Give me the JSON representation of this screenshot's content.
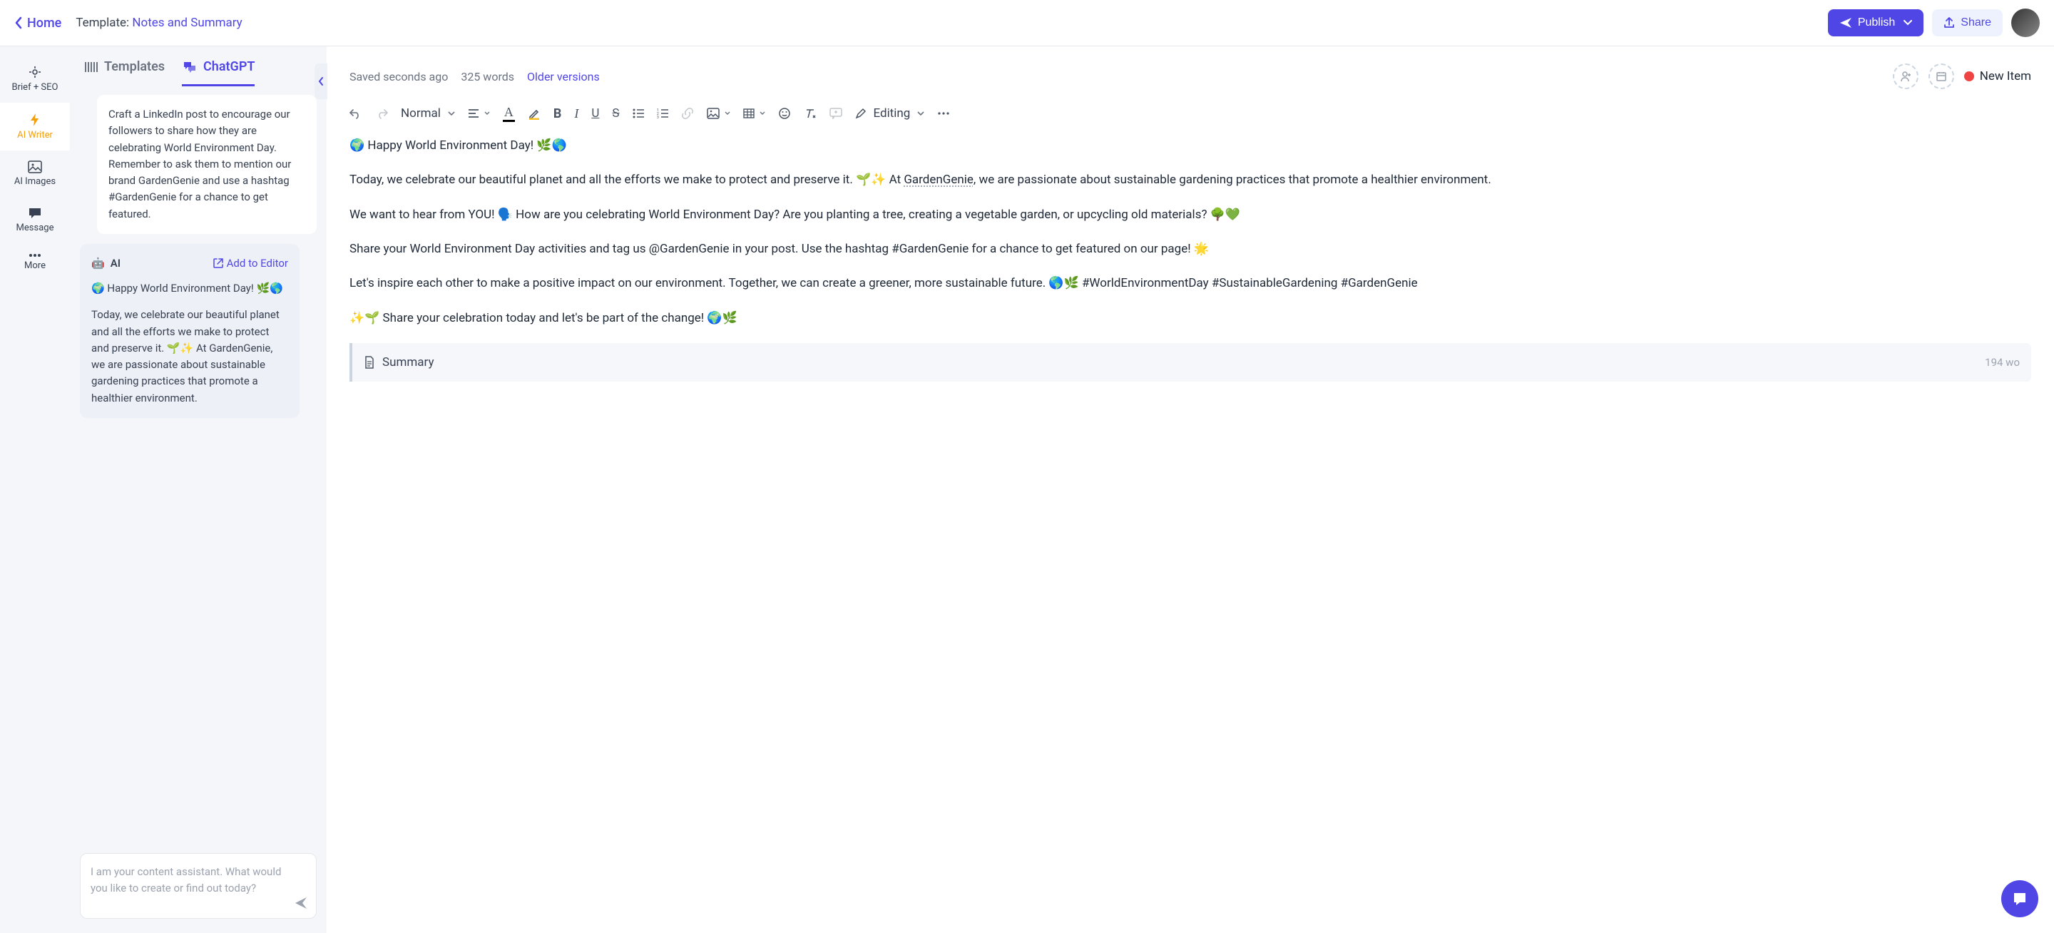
{
  "topbar": {
    "home": "Home",
    "template_prefix": "Template: ",
    "template_name": "Notes and Summary",
    "publish": "Publish",
    "share": "Share"
  },
  "leftnav": {
    "items": [
      {
        "label": "Brief + SEO",
        "icon": "target"
      },
      {
        "label": "AI Writer",
        "icon": "bolt"
      },
      {
        "label": "AI Images",
        "icon": "image"
      },
      {
        "label": "Message",
        "icon": "chat"
      },
      {
        "label": "More",
        "icon": "dots"
      }
    ],
    "active_index": 1
  },
  "side": {
    "tabs": {
      "templates": "Templates",
      "chatgpt": "ChatGPT",
      "active": "chatgpt"
    },
    "user_message": "Craft a LinkedIn post to encourage our followers to share how they are celebrating World Environment Day. Remember to ask them to mention our brand GardenGenie and use a hashtag #GardenGenie for a chance to get featured.",
    "ai_label": "AI",
    "add_to_editor": "Add to Editor",
    "ai_message_p1": "🌍 Happy World Environment Day! 🌿🌎",
    "ai_message_p2": "Today, we celebrate our beautiful planet and all the efforts we make to protect and preserve it. 🌱✨ At GardenGenie, we are passionate about sustainable gardening practices that promote a healthier environment.",
    "input_placeholder": "I am your content assistant. What would you like to create or find out today?"
  },
  "editor_meta": {
    "saved": "Saved seconds ago",
    "words": "325 words",
    "older": "Older versions",
    "new_item": "New Item"
  },
  "toolbar": {
    "style": "Normal",
    "mode": "Editing"
  },
  "document": {
    "p1": "🌍 Happy World Environment Day! 🌿🌎",
    "p2a": "Today, we celebrate our beautiful planet and all the efforts we make to protect and preserve it. 🌱✨ At ",
    "p2b": "GardenGenie",
    "p2c": ", we are passionate about sustainable gardening practices that promote a healthier environment.",
    "p3": "We want to hear from YOU! 🗣️ How are you celebrating World Environment Day? Are you planting a tree, creating a vegetable garden, or upcycling old materials? 🌳💚",
    "p4": "Share your World Environment Day activities and tag us @GardenGenie in your post. Use the hashtag #GardenGenie for a chance to get featured on our page! 🌟",
    "p5": "Let's inspire each other to make a positive impact on our environment. Together, we can create a greener, more sustainable future. 🌎🌿 #WorldEnvironmentDay #SustainableGardening #GardenGenie",
    "p6": "✨🌱 Share your celebration today and let's be part of the change! 🌍🌿"
  },
  "summary": {
    "label": "Summary",
    "wc": "194 wo"
  }
}
